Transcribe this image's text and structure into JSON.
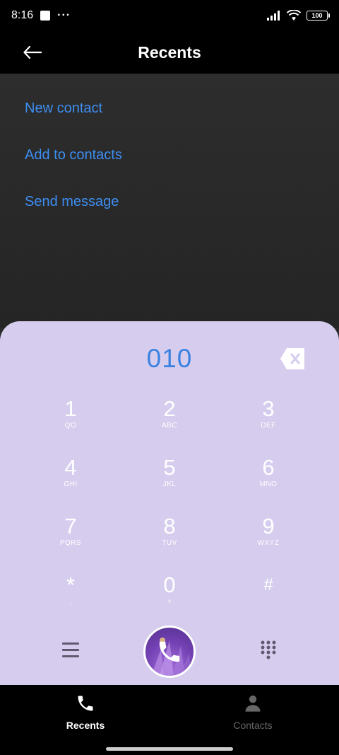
{
  "status": {
    "time": "8:16",
    "dots": "···",
    "battery": "100"
  },
  "header": {
    "title": "Recents"
  },
  "menu": [
    {
      "label": "New contact"
    },
    {
      "label": "Add to contacts"
    },
    {
      "label": "Send message"
    }
  ],
  "dialer": {
    "number": "010",
    "keys": [
      {
        "digit": "1",
        "letters": "QO"
      },
      {
        "digit": "2",
        "letters": "ABC"
      },
      {
        "digit": "3",
        "letters": "DEF"
      },
      {
        "digit": "4",
        "letters": "GHI"
      },
      {
        "digit": "5",
        "letters": "JKL"
      },
      {
        "digit": "6",
        "letters": "MNO"
      },
      {
        "digit": "7",
        "letters": "PQRS"
      },
      {
        "digit": "8",
        "letters": "TUV"
      },
      {
        "digit": "9",
        "letters": "WXYZ"
      },
      {
        "digit": "*",
        "letters": ","
      },
      {
        "digit": "0",
        "letters": "+"
      },
      {
        "digit": "#",
        "letters": ""
      }
    ]
  },
  "nav": {
    "recents": "Recents",
    "contacts": "Contacts"
  },
  "colors": {
    "accent_blue": "#3d8ef2",
    "dialer_bg": "#d6cdee",
    "call_purple": "#7240b2"
  },
  "icons": [
    "back-arrow-icon",
    "backspace-icon",
    "menu-icon",
    "phone-icon",
    "keypad-icon",
    "contact-person-icon"
  ]
}
